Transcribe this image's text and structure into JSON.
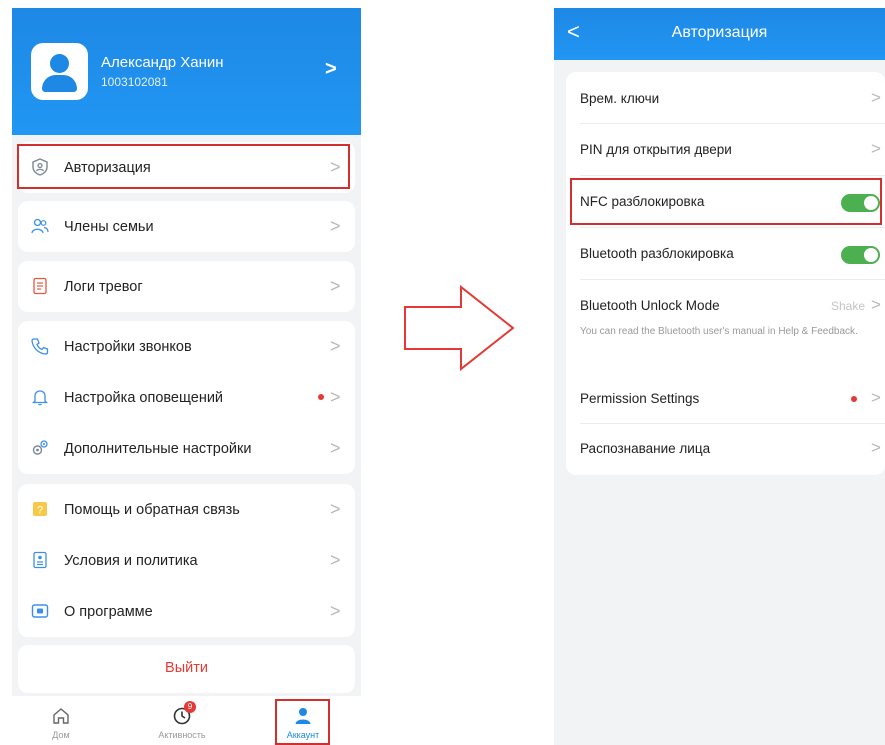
{
  "left": {
    "profile": {
      "name": "Александр Ханин",
      "id": "1003102081",
      "chevron": ">"
    },
    "menu_cards": [
      {
        "items": [
          {
            "label": "Авторизация",
            "icon": "shield-user-icon"
          }
        ]
      },
      {
        "items": [
          {
            "label": "Члены семьи",
            "icon": "family-icon"
          }
        ]
      },
      {
        "items": [
          {
            "label": "Логи тревог",
            "icon": "alarm-log-icon"
          }
        ]
      },
      {
        "items": [
          {
            "label": "Настройки звонков",
            "icon": "phone-icon"
          },
          {
            "label": "Настройка оповещений",
            "icon": "bell-icon",
            "dot": true
          },
          {
            "label": "Дополнительные настройки",
            "icon": "gears-icon"
          }
        ]
      },
      {
        "items": [
          {
            "label": "Помощь и обратная связь",
            "icon": "help-icon"
          },
          {
            "label": "Условия и политика",
            "icon": "document-icon"
          },
          {
            "label": "О программе",
            "icon": "info-icon"
          }
        ]
      }
    ],
    "logout_label": "Выйти",
    "tabbar": {
      "tabs": [
        {
          "label": "Дом",
          "icon": "home-icon"
        },
        {
          "label": "Активность",
          "icon": "clock-icon",
          "badge": "9"
        },
        {
          "label": "Аккаунт",
          "icon": "account-icon",
          "active": true
        }
      ]
    },
    "chevron": ">"
  },
  "right": {
    "nav": {
      "back": "<",
      "title": "Авторизация"
    },
    "items": [
      {
        "label": "Врем. ключи",
        "type": "chevron"
      },
      {
        "label": "PIN для открытия двери",
        "type": "chevron"
      },
      {
        "label": "NFC разблокировка",
        "type": "toggle",
        "on": true
      },
      {
        "label": "Bluetooth разблокировка",
        "type": "toggle",
        "on": true
      },
      {
        "label": "Bluetooth Unlock Mode",
        "type": "value",
        "value": "Shake"
      },
      {
        "label": "Permission Settings",
        "type": "chevron",
        "dot": true
      },
      {
        "label": "Распознавание лица",
        "type": "chevron"
      }
    ],
    "hint": "You can read the Bluetooth user's manual in Help & Feedback.",
    "chevron": ">"
  },
  "colors": {
    "accent": "#1e88e5",
    "highlight": "#d32f2f",
    "toggle_on": "#4caf50",
    "alert": "#e53935"
  }
}
